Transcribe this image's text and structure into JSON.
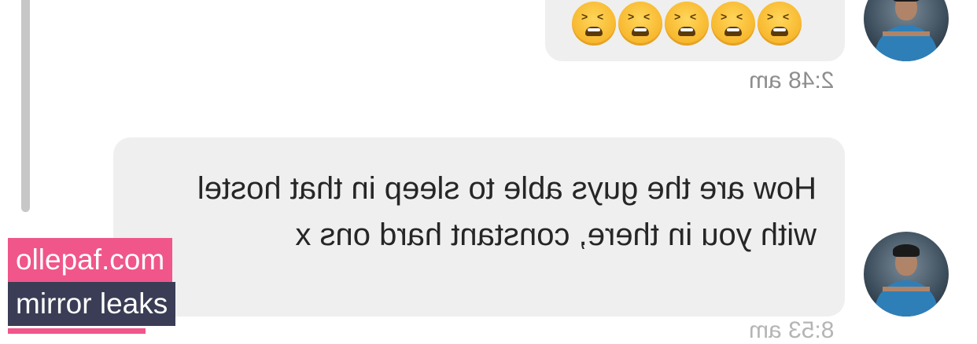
{
  "conversation": {
    "messages": [
      {
        "type": "emoji",
        "emoji_icons": [
          "tired-face-emoji",
          "tired-face-emoji",
          "tired-face-emoji",
          "tired-face-emoji",
          "tired-face-emoji"
        ],
        "timestamp": "2:48 am"
      },
      {
        "type": "text",
        "text": "How are the guys able to sleep in that hostel with you in there, constant hard ons x",
        "timestamp": "8:53 am"
      }
    ],
    "rendering": "mirrored-horizontally"
  },
  "watermark": {
    "line1": "ollepaf.com",
    "line2": "mirror leaks",
    "colors": {
      "line1_bg": "#f0568a",
      "line2_bg": "#3a3d55"
    }
  },
  "colors": {
    "bubble": "#efefef",
    "timestamp": "#8e8e8e",
    "text": "#262626",
    "scrollbar": "#c7c7c7"
  }
}
